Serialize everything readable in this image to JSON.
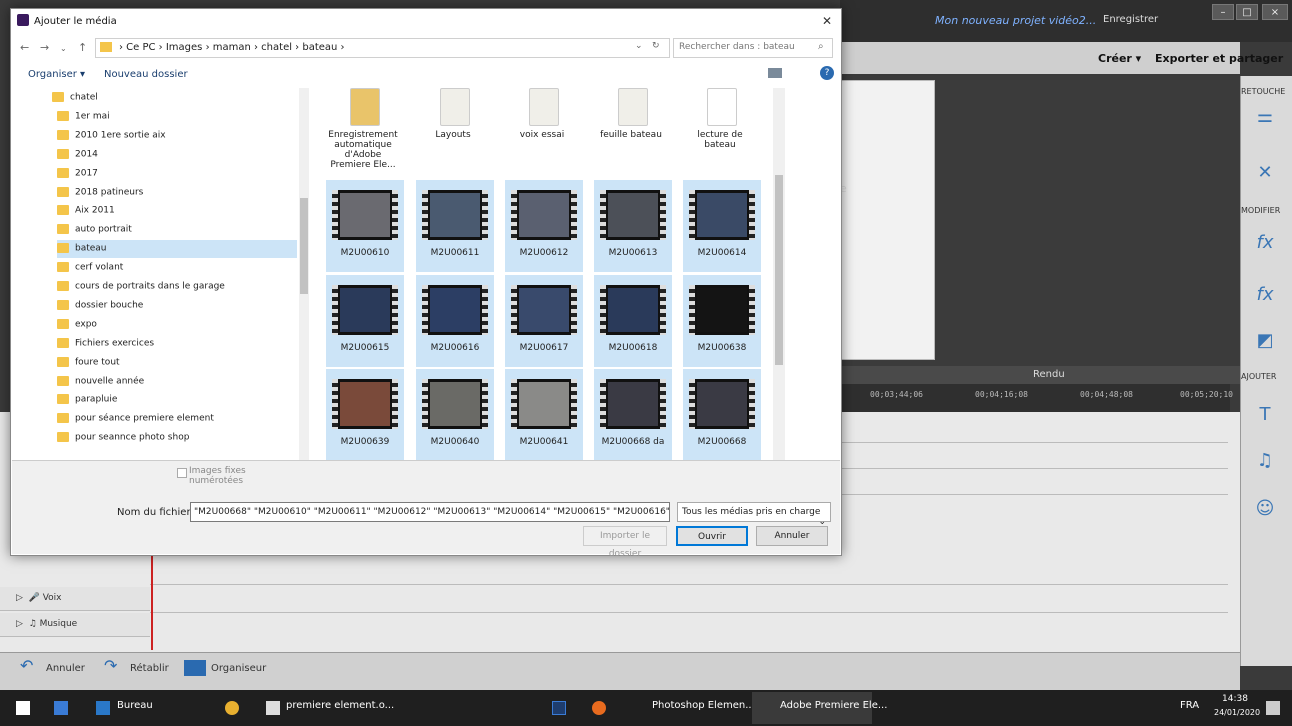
{
  "app": {
    "project_title": "Mon nouveau projet vidéo2...",
    "save_label": "Enregistrer",
    "create_label": "Créer ▾",
    "export_label": "Exporter et partager",
    "retouche": "RETOUCHE",
    "modifier": "MODIFIER",
    "ajouter": "AJOUTER",
    "rendu": "Rendu",
    "timecodes": [
      "00;03;44;06",
      "00;04;16;08",
      "00;04;48;08",
      "00;05;20;10"
    ],
    "tracks": [
      "Voix",
      "Musique"
    ],
    "undo": "Annuler",
    "redo": "Rétablir",
    "organizer": "Organiseur",
    "preview_letter": "e"
  },
  "dialog": {
    "title": "Ajouter le média",
    "path": "› Ce PC  ›  Images  ›  maman  ›  chatel  ›  bateau  ›",
    "search_placeholder": "Rechercher dans : bateau",
    "organize": "Organiser ▾",
    "new_folder": "Nouveau dossier",
    "tree": [
      "chatel",
      "1er mai",
      "2010 1ere sortie aix",
      "2014",
      "2017",
      "2018 patineurs",
      "Aix  2011",
      "auto portrait",
      "bateau",
      "cerf volant",
      "cours de portraits dans le garage",
      "dossier bouche",
      "expo",
      "Fichiers exercices",
      "foure tout",
      "nouvelle année",
      "parapluie",
      "pour séance  premiere  element",
      "pour seannce photo shop"
    ],
    "selected_folder": "bateau",
    "top_files": [
      "Enregistrement automatique d'Adobe Premiere Ele...",
      "Layouts",
      "voix essai",
      "feuille bateau",
      "lecture de bateau"
    ],
    "videos": [
      "M2U00610",
      "M2U00611",
      "M2U00612",
      "M2U00613",
      "M2U00614",
      "M2U00615",
      "M2U00616",
      "M2U00617",
      "M2U00618",
      "M2U00638",
      "M2U00639",
      "M2U00640",
      "M2U00641",
      "M2U00668  da",
      "M2U00668"
    ],
    "images_fixes": "Images fixes numérotées",
    "filename_label": "Nom du fichier :",
    "filename_value": "\"M2U00668\" \"M2U00610\" \"M2U00611\" \"M2U00612\" \"M2U00613\" \"M2U00614\" \"M2U00615\" \"M2U00616\" \"M2U",
    "filetype": "Tous les médias pris en charge",
    "import_folder": "Importer le dossier",
    "open": "Ouvrir",
    "cancel": "Annuler"
  },
  "taskbar": {
    "items": [
      "Bureau",
      "premiere element.o...",
      "Photoshop Elemen...",
      "Adobe Premiere Ele..."
    ],
    "lang": "FRA",
    "time": "14:38",
    "date": "24/01/2020"
  }
}
